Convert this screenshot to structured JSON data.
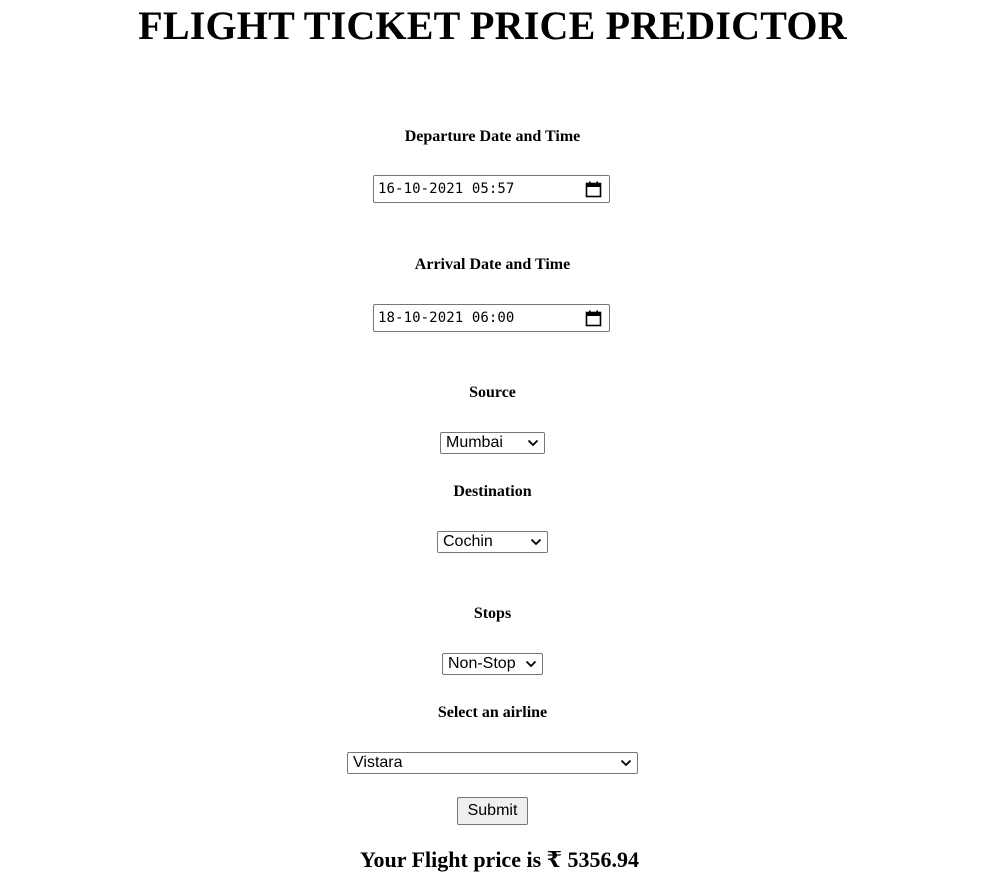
{
  "page": {
    "title": "FLIGHT TICKET PRICE PREDICTOR"
  },
  "form": {
    "departure": {
      "label": "Departure Date and Time",
      "value": "16-10-2021 05:57",
      "icon": "calendar-icon"
    },
    "arrival": {
      "label": "Arrival Date and Time",
      "value": "18-10-2021 06:00",
      "icon": "calendar-icon"
    },
    "source": {
      "label": "Source",
      "selected": "Mumbai"
    },
    "destination": {
      "label": "Destination",
      "selected": "Cochin"
    },
    "stops": {
      "label": "Stops",
      "selected": "Non-Stop"
    },
    "airline": {
      "label": "Select an airline",
      "selected": "Vistara"
    },
    "submit_label": "Submit"
  },
  "result": {
    "text": "Your Flight price is ₹ 5356.94"
  }
}
